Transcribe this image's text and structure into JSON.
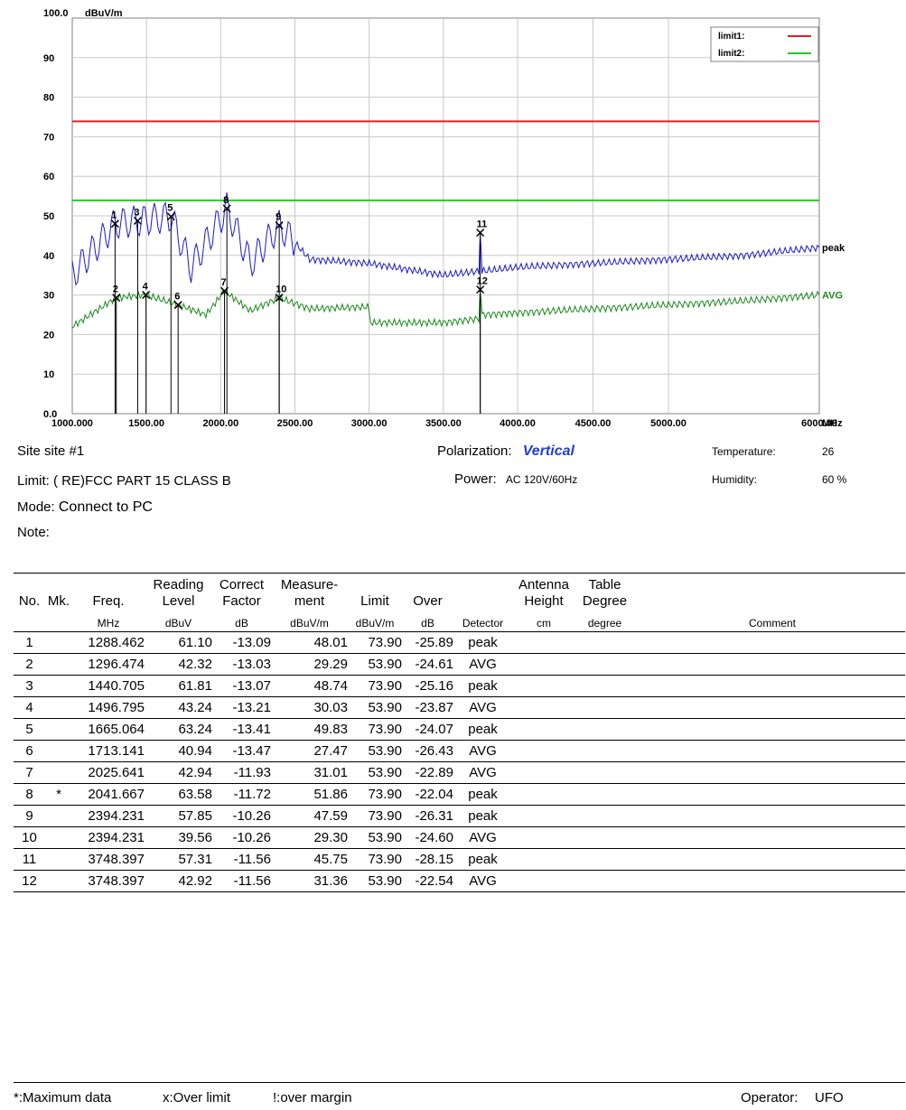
{
  "chart_data": {
    "type": "line",
    "y_top_label": "100.0",
    "y_unit": "dBuV/m",
    "x_unit": "MHz",
    "ylim": [
      0,
      100
    ],
    "xlim": [
      1000,
      6000
    ],
    "y_ticks": [
      {
        "v": 90,
        "label": "90"
      },
      {
        "v": 80,
        "label": "80"
      },
      {
        "v": 70,
        "label": "70"
      },
      {
        "v": 60,
        "label": "60"
      },
      {
        "v": 50,
        "label": "50"
      },
      {
        "v": 40,
        "label": "40"
      },
      {
        "v": 30,
        "label": "30"
      },
      {
        "v": 20,
        "label": "20"
      },
      {
        "v": 10,
        "label": "10"
      },
      {
        "v": 0,
        "label": "0.0"
      }
    ],
    "x_ticks": [
      {
        "v": 1000,
        "label": "1000.000"
      },
      {
        "v": 1500,
        "label": "1500.00"
      },
      {
        "v": 2000,
        "label": "2000.00"
      },
      {
        "v": 2500,
        "label": "2500.00"
      },
      {
        "v": 3000,
        "label": "3000.00"
      },
      {
        "v": 3500,
        "label": "3500.00"
      },
      {
        "v": 4000,
        "label": "4000.00"
      },
      {
        "v": 4500,
        "label": "4500.00"
      },
      {
        "v": 5000,
        "label": "5000.00"
      },
      {
        "v": 6000,
        "label": "6000.00"
      }
    ],
    "limits": [
      {
        "name": "limit1:",
        "value": 73.9,
        "color": "#e02020"
      },
      {
        "name": "limit2:",
        "value": 53.9,
        "color": "#22cc22"
      }
    ],
    "series": [
      {
        "name": "peak",
        "color": "#1a1ad0",
        "label_color": "#000000",
        "x": [
          1000,
          1288,
          1440,
          1665,
          1800,
          2041,
          2200,
          2394,
          2600,
          3000,
          3500,
          3740,
          3748,
          3760,
          4000,
          4500,
          5000,
          5500,
          6000
        ],
        "y": [
          35,
          48,
          48.7,
          49.8,
          37,
          51.9,
          38,
          47.6,
          39,
          38,
          35,
          36,
          45.7,
          36,
          37,
          38,
          39,
          40,
          42
        ]
      },
      {
        "name": "AVG",
        "color": "#1a8a1a",
        "label_color": "#1a8a1a",
        "x": [
          1000,
          1296,
          1496,
          1713,
          1900,
          2025,
          2200,
          2394,
          2600,
          2990,
          3010,
          3500,
          3740,
          3748,
          3760,
          4000,
          4500,
          5000,
          5500,
          6000
        ],
        "y": [
          22,
          29.3,
          30,
          27.5,
          25,
          31,
          26,
          29.3,
          26.5,
          27,
          23,
          23,
          24,
          31.4,
          25,
          25.5,
          26.5,
          27.5,
          28.5,
          30
        ]
      }
    ],
    "markers": [
      {
        "label": "1",
        "x": 1288.462,
        "y": 48.01
      },
      {
        "label": "2",
        "x": 1296.474,
        "y": 29.29
      },
      {
        "label": "3",
        "x": 1440.705,
        "y": 48.74
      },
      {
        "label": "4",
        "x": 1496.795,
        "y": 30.03
      },
      {
        "label": "5",
        "x": 1665.064,
        "y": 49.83
      },
      {
        "label": "6",
        "x": 1713.141,
        "y": 27.47
      },
      {
        "label": "7",
        "x": 2025.641,
        "y": 31.01
      },
      {
        "label": "8",
        "x": 2041.667,
        "y": 51.86
      },
      {
        "label": "9",
        "x": 2394.231,
        "y": 47.59
      },
      {
        "label": "10",
        "x": 2394.231,
        "y": 29.3
      },
      {
        "label": "11",
        "x": 3748.397,
        "y": 45.75
      },
      {
        "label": "12",
        "x": 3748.397,
        "y": 31.36
      }
    ],
    "grid": true,
    "legend_position": "top-right"
  },
  "info": {
    "site_label": "Site",
    "site_value": "site #1",
    "limit_label": "Limit:",
    "limit_value": "( RE)FCC PART 15 CLASS B",
    "mode_label": "Mode:",
    "mode_value": "Connect to PC",
    "note_label": "Note:",
    "polarization_label": "Polarization:",
    "polarization_value": "Vertical",
    "power_label": "Power:",
    "power_value": "AC 120V/60Hz",
    "temperature_label": "Temperature:",
    "temperature_value": "26",
    "humidity_label": "Humidity:",
    "humidity_value": "60 %"
  },
  "table": {
    "headers": {
      "no": "No.",
      "mk": "Mk.",
      "freq": "Freq.",
      "reading_a": "Reading",
      "reading_b": "Level",
      "correct_a": "Correct",
      "correct_b": "Factor",
      "measure_a": "Measure-",
      "measure_b": "ment",
      "limit": "Limit",
      "over": "Over",
      "antenna_a": "Antenna",
      "antenna_b": "Height",
      "table_a": "Table",
      "table_b": "Degree"
    },
    "units": {
      "freq": "MHz",
      "reading": "dBuV",
      "correct": "dB",
      "measure": "dBuV/m",
      "limit": "dBuV/m",
      "over": "dB",
      "detector": "Detector",
      "antenna": "cm",
      "table": "degree",
      "comment": "Comment"
    },
    "rows": [
      {
        "no": "1",
        "mk": "",
        "freq": "1288.462",
        "reading": "61.10",
        "correct": "-13.09",
        "measure": "48.01",
        "limit": "73.90",
        "over": "-25.89",
        "detector": "peak"
      },
      {
        "no": "2",
        "mk": "",
        "freq": "1296.474",
        "reading": "42.32",
        "correct": "-13.03",
        "measure": "29.29",
        "limit": "53.90",
        "over": "-24.61",
        "detector": "AVG"
      },
      {
        "no": "3",
        "mk": "",
        "freq": "1440.705",
        "reading": "61.81",
        "correct": "-13.07",
        "measure": "48.74",
        "limit": "73.90",
        "over": "-25.16",
        "detector": "peak"
      },
      {
        "no": "4",
        "mk": "",
        "freq": "1496.795",
        "reading": "43.24",
        "correct": "-13.21",
        "measure": "30.03",
        "limit": "53.90",
        "over": "-23.87",
        "detector": "AVG"
      },
      {
        "no": "5",
        "mk": "",
        "freq": "1665.064",
        "reading": "63.24",
        "correct": "-13.41",
        "measure": "49.83",
        "limit": "73.90",
        "over": "-24.07",
        "detector": "peak"
      },
      {
        "no": "6",
        "mk": "",
        "freq": "1713.141",
        "reading": "40.94",
        "correct": "-13.47",
        "measure": "27.47",
        "limit": "53.90",
        "over": "-26.43",
        "detector": "AVG"
      },
      {
        "no": "7",
        "mk": "",
        "freq": "2025.641",
        "reading": "42.94",
        "correct": "-11.93",
        "measure": "31.01",
        "limit": "53.90",
        "over": "-22.89",
        "detector": "AVG"
      },
      {
        "no": "8",
        "mk": "*",
        "freq": "2041.667",
        "reading": "63.58",
        "correct": "-11.72",
        "measure": "51.86",
        "limit": "73.90",
        "over": "-22.04",
        "detector": "peak"
      },
      {
        "no": "9",
        "mk": "",
        "freq": "2394.231",
        "reading": "57.85",
        "correct": "-10.26",
        "measure": "47.59",
        "limit": "73.90",
        "over": "-26.31",
        "detector": "peak"
      },
      {
        "no": "10",
        "mk": "",
        "freq": "2394.231",
        "reading": "39.56",
        "correct": "-10.26",
        "measure": "29.30",
        "limit": "53.90",
        "over": "-24.60",
        "detector": "AVG"
      },
      {
        "no": "11",
        "mk": "",
        "freq": "3748.397",
        "reading": "57.31",
        "correct": "-11.56",
        "measure": "45.75",
        "limit": "73.90",
        "over": "-28.15",
        "detector": "peak"
      },
      {
        "no": "12",
        "mk": "",
        "freq": "3748.397",
        "reading": "42.92",
        "correct": "-11.56",
        "measure": "31.36",
        "limit": "53.90",
        "over": "-22.54",
        "detector": "AVG"
      }
    ]
  },
  "footer": {
    "maximum_data": "*:Maximum data",
    "over_limit": "x:Over limit",
    "over_margin": "!:over margin",
    "operator_label": "Operator:",
    "operator_value": "UFO"
  }
}
